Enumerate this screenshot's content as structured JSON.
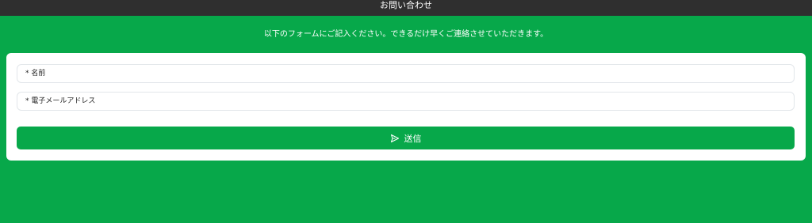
{
  "header": {
    "title": "お問い合わせ"
  },
  "intro": {
    "text": "以下のフォームにご記入ください。できるだけ早くご連絡させていただきます。"
  },
  "form": {
    "name_placeholder": "* 名前",
    "email_placeholder": "* 電子メールアドレス",
    "submit_label": "送信",
    "submit_icon": "send-icon"
  },
  "colors": {
    "background": "#07a84a",
    "header": "#2f2f2f",
    "button": "#07a84a",
    "card": "#ffffff"
  }
}
